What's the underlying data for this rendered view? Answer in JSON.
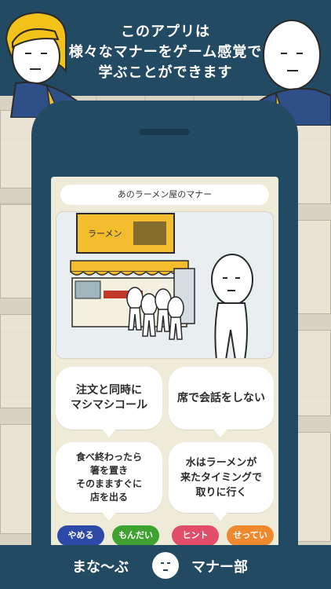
{
  "banner": {
    "line1": "このアプリは",
    "line2": "様々なマナーをゲーム感覚で",
    "line3": "学ぶことができます"
  },
  "game": {
    "stage_title": "あのラーメン屋のマナー",
    "shop_sign": "ラーメン",
    "choices": [
      {
        "label": "注文と同時に\nマシマシコール"
      },
      {
        "label": "席で会話をしない"
      },
      {
        "label": "食べ終わったら\n箸を置き\nそのまますぐに\n店を出る"
      },
      {
        "label": "水はラーメンが\n来たタイミングで\n取りに行く"
      }
    ],
    "buttons": {
      "quit": "やめる",
      "question": "もんだい",
      "hint": "ヒント",
      "settings": "せってい"
    },
    "button_colors": {
      "quit": "#2e4aa8",
      "question": "#3fa12f",
      "hint": "#e24d6a",
      "settings": "#ee8a2d"
    }
  },
  "footer": {
    "left": "まな〜ぶ",
    "right": "マナー部"
  },
  "colors": {
    "navy": "#234a63",
    "screen_bg": "#efebd9",
    "sign_yellow": "#f3bd2e"
  }
}
